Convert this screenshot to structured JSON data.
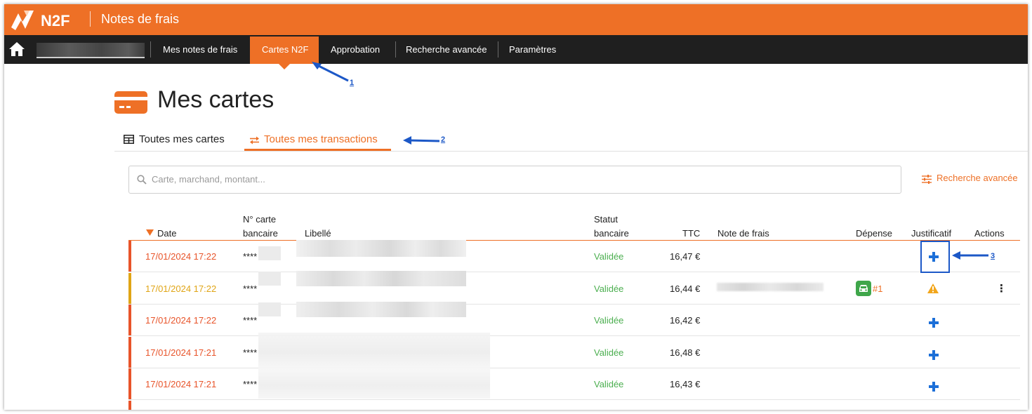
{
  "app": {
    "logo_text": "N2F",
    "title": "Notes de frais"
  },
  "nav": {
    "items": [
      {
        "label": "Mes notes de frais"
      },
      {
        "label": "Cartes N2F",
        "active": true
      },
      {
        "label": "Approbation"
      },
      {
        "label": "Recherche avancée"
      },
      {
        "label": "Paramètres"
      }
    ]
  },
  "page": {
    "title": "Mes cartes",
    "tabs": [
      {
        "label": "Toutes mes cartes"
      },
      {
        "label": "Toutes mes transactions",
        "active": true
      }
    ],
    "search_placeholder": "Carte, marchand, montant...",
    "advanced_search": "Recherche avancée"
  },
  "table": {
    "headers": {
      "date": "Date",
      "card_line1": "N° carte",
      "card_line2": "bancaire",
      "label": "Libellé",
      "status_line1": "Statut",
      "status_line2": "bancaire",
      "ttc": "TTC",
      "note": "Note de frais",
      "expense": "Dépense",
      "receipt": "Justificatif",
      "actions": "Actions"
    },
    "rows": [
      {
        "date": "17/01/2024 17:22",
        "card": "****",
        "status": "Validée",
        "ttc": "16,47 €",
        "receipt": "plus",
        "color": "#e8542a"
      },
      {
        "date": "17/01/2024 17:22",
        "card": "****",
        "status": "Validée",
        "ttc": "16,44 €",
        "expense_ref": "#1",
        "receipt": "warning",
        "actions": "⋮",
        "color": "#e0a516"
      },
      {
        "date": "17/01/2024 17:22",
        "card": "****",
        "status": "Validée",
        "ttc": "16,42 €",
        "receipt": "plus",
        "color": "#e8542a"
      },
      {
        "date": "17/01/2024 17:21",
        "card": "****",
        "status": "Validée",
        "ttc": "16,48 €",
        "receipt": "plus",
        "color": "#e8542a"
      },
      {
        "date": "17/01/2024 17:21",
        "card": "****",
        "status": "Validée",
        "ttc": "16,43 €",
        "receipt": "plus",
        "color": "#e8542a"
      }
    ]
  },
  "annotations": [
    "1",
    "2",
    "3"
  ],
  "colors": {
    "brand_orange": "#ee7026",
    "nav_black": "#1f1f1f",
    "status_green": "#4caf50",
    "date_red": "#e8542a",
    "date_amber": "#e0a516",
    "annotation_blue": "#1c58c7"
  }
}
